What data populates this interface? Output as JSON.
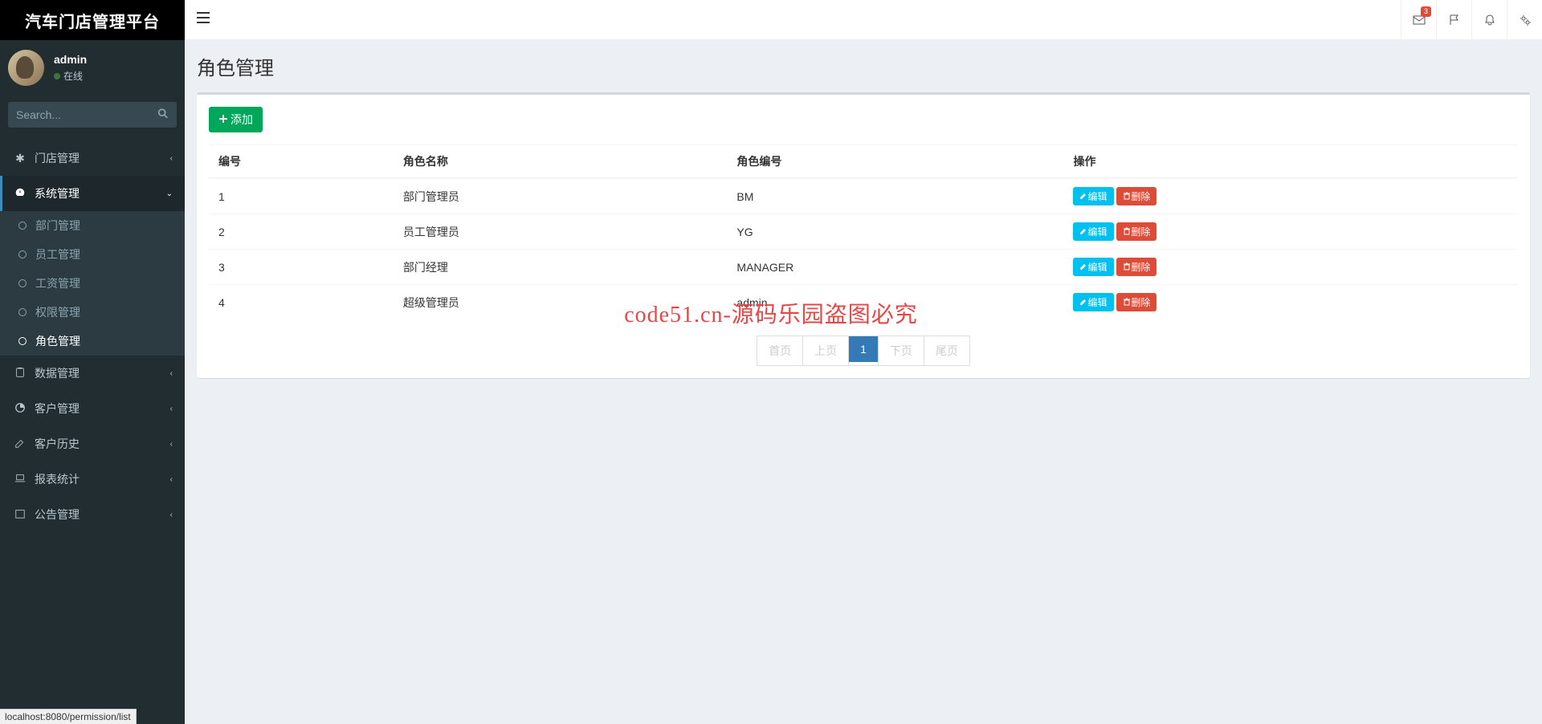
{
  "brand": "汽车门店管理平台",
  "user": {
    "name": "admin",
    "status": "在线"
  },
  "search": {
    "placeholder": "Search..."
  },
  "sidebar": {
    "items": [
      {
        "label": "门店管理"
      },
      {
        "label": "系统管理"
      },
      {
        "label": "数据管理"
      },
      {
        "label": "客户管理"
      },
      {
        "label": "客户历史"
      },
      {
        "label": "报表统计"
      },
      {
        "label": "公告管理"
      }
    ],
    "system_sub": [
      {
        "label": "部门管理"
      },
      {
        "label": "员工管理"
      },
      {
        "label": "工资管理"
      },
      {
        "label": "权限管理"
      },
      {
        "label": "角色管理"
      }
    ]
  },
  "topbar": {
    "badge_count": "3"
  },
  "page": {
    "title": "角色管理"
  },
  "toolbar": {
    "add_label": "添加"
  },
  "table": {
    "headers": {
      "id": "编号",
      "name": "角色名称",
      "code": "角色编号",
      "ops": "操作"
    },
    "rows": [
      {
        "id": "1",
        "name": "部门管理员",
        "code": "BM"
      },
      {
        "id": "2",
        "name": "员工管理员",
        "code": "YG"
      },
      {
        "id": "3",
        "name": "部门经理",
        "code": "MANAGER"
      },
      {
        "id": "4",
        "name": "超级管理员",
        "code": "admin"
      }
    ],
    "actions": {
      "edit": "编辑",
      "delete": "删除"
    }
  },
  "pagination": {
    "first": "首页",
    "prev": "上页",
    "current": "1",
    "next": "下页",
    "last": "尾页"
  },
  "watermark": "code51.cn-源码乐园盗图必究",
  "status_url": "localhost:8080/permission/list"
}
